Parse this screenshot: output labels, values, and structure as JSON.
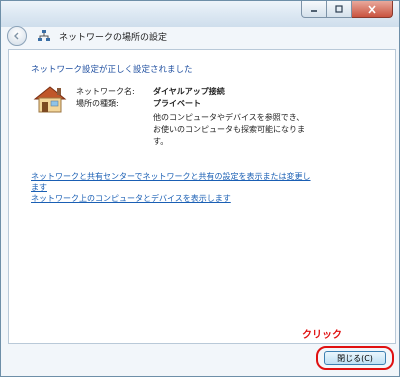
{
  "window": {
    "header_title": "ネットワークの場所の設定"
  },
  "main": {
    "heading": "ネットワーク設定が正しく設定されました",
    "network_name_label": "ネットワーク名:",
    "network_name_value": "ダイヤルアップ接続",
    "location_type_label": "場所の種類:",
    "location_type_value": "プライベート",
    "description_lines": [
      "他のコンピュータやデバイスを参照でき、",
      "お使いのコンピュータも探索可能になりま",
      "す。"
    ],
    "links": {
      "link1_line1": "ネットワークと共有センターでネットワークと共有の設定を表示または変更し",
      "link1_line2": "ます",
      "link2": "ネットワーク上のコンピュータとデバイスを表示します"
    }
  },
  "annotation": {
    "click_label": "クリック"
  },
  "footer": {
    "close_button_label": "閉じる(C)"
  },
  "colors": {
    "heading": "#1f4fa0",
    "link": "#1a5fb4",
    "annotation": "#e01010"
  },
  "icons": [
    "back-arrow-icon",
    "network-icon",
    "house-icon",
    "minimize-icon",
    "maximize-icon",
    "close-icon"
  ]
}
